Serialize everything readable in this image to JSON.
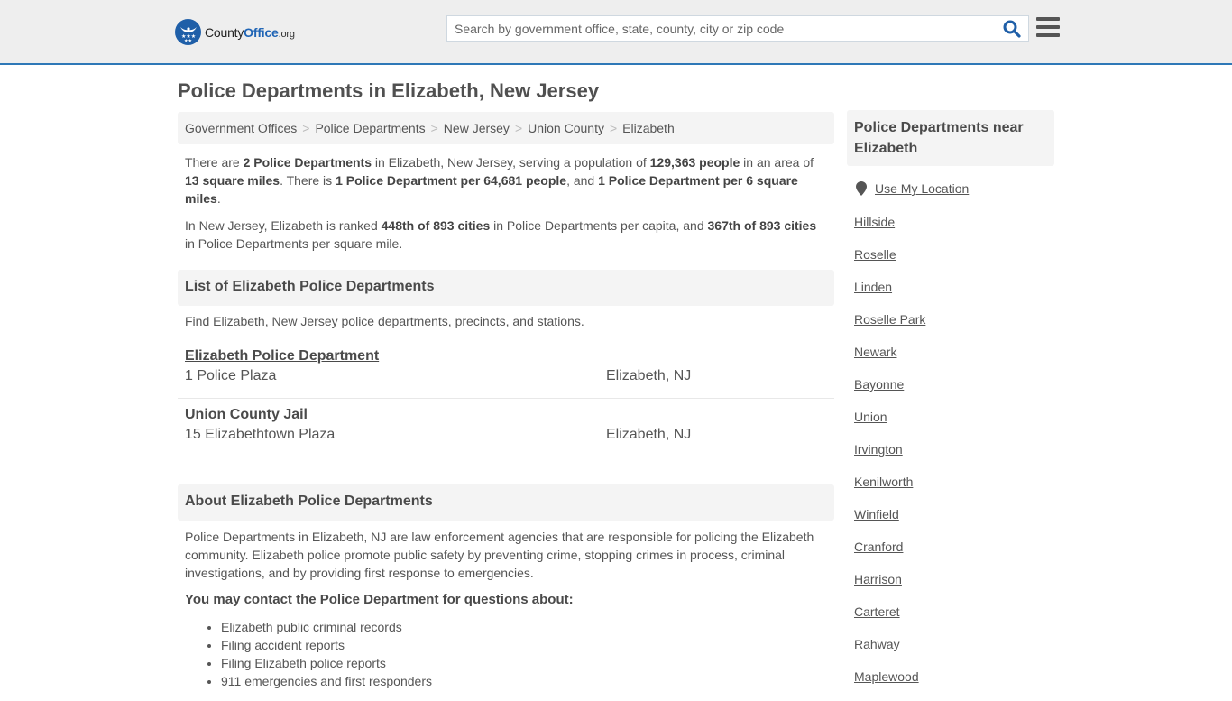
{
  "header": {
    "logo": {
      "brand_county": "County",
      "brand_office": "Office",
      "brand_tld": ".org"
    },
    "search": {
      "placeholder": "Search by government office, state, county, city or zip code",
      "value": ""
    },
    "icons": {
      "search": "search-icon",
      "menu": "hamburger-menu-icon",
      "logo": "eagle-stars-logo-icon"
    }
  },
  "page": {
    "title": "Police Departments in Elizabeth, New Jersey"
  },
  "breadcrumb": [
    {
      "label": "Government Offices"
    },
    {
      "label": "Police Departments"
    },
    {
      "label": "New Jersey"
    },
    {
      "label": "Union County"
    },
    {
      "label": "Elizabeth"
    }
  ],
  "breadcrumb_separator": ">",
  "intro": {
    "p1": {
      "t1": "There are ",
      "b1": "2 Police Departments",
      "t2": " in Elizabeth, New Jersey, serving a population of ",
      "b2": "129,363 people",
      "t3": " in an area of ",
      "b3": "13 square miles",
      "t4": ". There is ",
      "b4": "1 Police Department per 64,681 people",
      "t5": ", and ",
      "b5": "1 Police Department per 6 square miles",
      "t6": "."
    },
    "p2": {
      "t1": "In New Jersey, Elizabeth is ranked ",
      "b1": "448th of 893 cities",
      "t2": " in Police Departments per capita, and ",
      "b2": "367th of 893 cities",
      "t3": " in Police Departments per square mile."
    }
  },
  "list_section": {
    "heading": "List of Elizabeth Police Departments",
    "description": "Find Elizabeth, New Jersey police departments, precincts, and stations.",
    "departments": [
      {
        "name": "Elizabeth Police Department",
        "address": "1 Police Plaza",
        "city": "Elizabeth, NJ"
      },
      {
        "name": "Union County Jail",
        "address": "15 Elizabethtown Plaza",
        "city": "Elizabeth, NJ"
      }
    ]
  },
  "about_section": {
    "heading": "About Elizabeth Police Departments",
    "body": "Police Departments in Elizabeth, NJ are law enforcement agencies that are responsible for policing the Elizabeth community. Elizabeth police promote public safety by preventing crime, stopping crimes in process, criminal investigations, and by providing first response to emergencies.",
    "contact_heading": "You may contact the Police Department for questions about:",
    "contact_items": [
      "Elizabeth public criminal records",
      "Filing accident reports",
      "Filing Elizabeth police reports",
      "911 emergencies and first responders"
    ]
  },
  "sidebar": {
    "heading": "Police Departments near Elizabeth",
    "use_location": "Use My Location",
    "nearby": [
      "Hillside",
      "Roselle",
      "Linden",
      "Roselle Park",
      "Newark",
      "Bayonne",
      "Union",
      "Irvington",
      "Kenilworth",
      "Winfield",
      "Cranford",
      "Harrison",
      "Carteret",
      "Rahway",
      "Maplewood"
    ]
  },
  "colors": {
    "accent": "#2e78b7",
    "brand_blue": "#1f5fa8",
    "header_bg": "#eeeeee",
    "panel_bg": "#f4f4f4",
    "text": "#555555"
  }
}
